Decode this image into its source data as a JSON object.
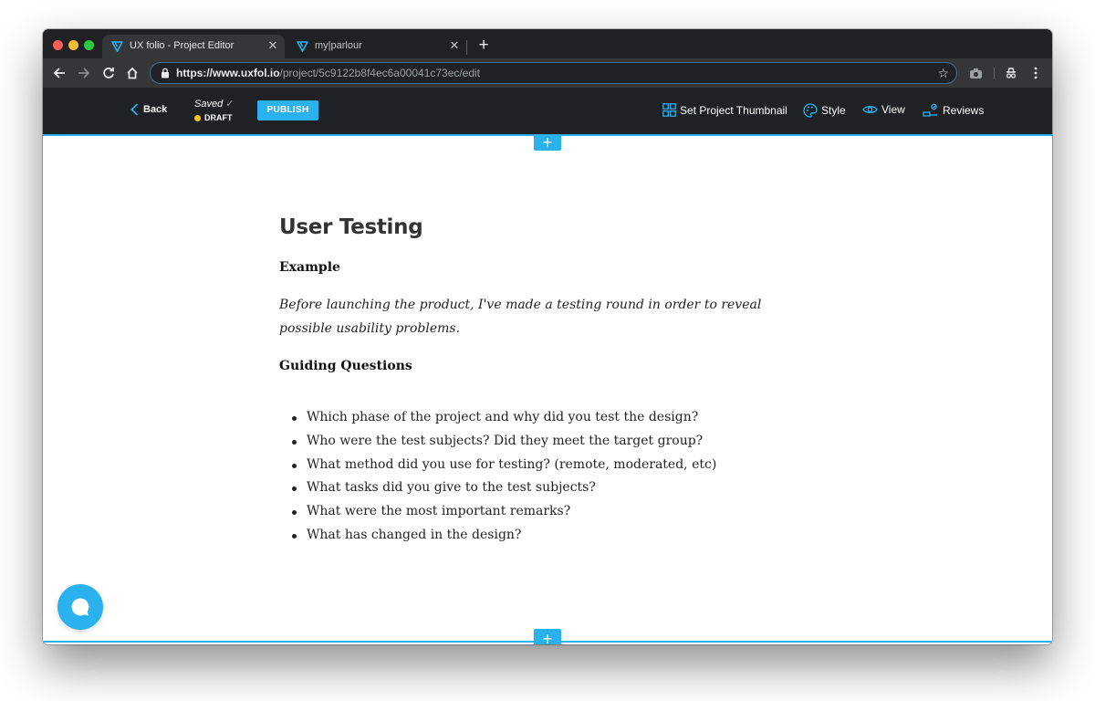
{
  "browser": {
    "tabs": [
      {
        "title": "UX folio - Project Editor",
        "active": true,
        "favicon": "uxfolio-logo-icon"
      },
      {
        "title": "my|parlour",
        "active": false,
        "favicon": "uxfolio-logo-icon"
      }
    ],
    "url_host": "https://www.uxfol.io",
    "url_path": "/project/5c9122b8f4ec6a00041c73ec/edit"
  },
  "editor": {
    "back_label": "Back",
    "saved_label": "Saved",
    "draft_label": "DRAFT",
    "publish_label": "PUBLISH",
    "actions": [
      {
        "label": "Set Project Thumbnail",
        "icon": "grid-icon"
      },
      {
        "label": "Style",
        "icon": "palette-icon"
      },
      {
        "label": "View",
        "icon": "eye-icon"
      },
      {
        "label": "Reviews",
        "icon": "reviews-icon"
      }
    ]
  },
  "content": {
    "title": "User Testing",
    "example_heading": "Example",
    "example_text": "Before launching the product, I've made a testing round in order to reveal possible usability problems.",
    "guiding_heading": "Guiding Questions",
    "questions": [
      "Which phase of the project and why did you test the design?",
      "Who were the test subjects? Did they meet the target group?",
      "What method did you use for testing? (remote, moderated, etc)",
      "What tasks did you give to the test subjects?",
      "What were the most important remarks?",
      "What has changed in the design?"
    ]
  },
  "colors": {
    "accent": "#2ab2ef",
    "chrome_dark": "#202124",
    "chrome_toolbar": "#35363a",
    "draft_dot": "#f5c518"
  }
}
